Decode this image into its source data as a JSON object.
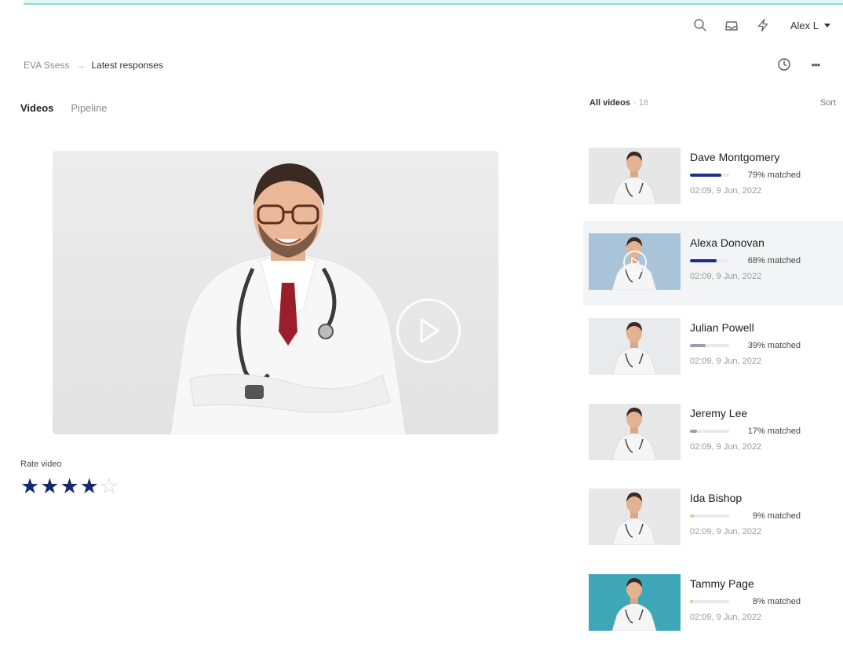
{
  "header": {
    "user_name": "Alex L",
    "icons": [
      "search-icon",
      "inbox-icon",
      "lightning-icon",
      "chevron-down-icon"
    ]
  },
  "breadcrumb": {
    "root": "EVA Ssess",
    "separator": "→",
    "current": "Latest responses"
  },
  "header_actions": {
    "icons": [
      "history-icon",
      "more-icon"
    ],
    "more_label": "•••"
  },
  "tabs": [
    {
      "label": "Videos",
      "active": true
    },
    {
      "label": "Pipeline",
      "active": false
    }
  ],
  "player": {
    "icon": "play-icon"
  },
  "rating": {
    "label": "Rate video",
    "value": 4,
    "max": 5,
    "filled_char": "★",
    "empty_char": "☆"
  },
  "list": {
    "title": "All videos",
    "count": "· 18",
    "sort_label": "Sort",
    "videos": [
      {
        "name": "Dave Montgomery",
        "match": "79% matched",
        "match_pct": 79,
        "bar_color": "#1a2f8f",
        "date": "02:09, 9 Jun, 2022",
        "selected": false,
        "thumb_bg": "#e6e6e6"
      },
      {
        "name": "Alexa Donovan",
        "match": "68% matched",
        "match_pct": 68,
        "bar_color": "#1a2f8f",
        "date": "02:09, 9 Jun, 2022",
        "selected": true,
        "thumb_bg": "#a9c4d8"
      },
      {
        "name": "Julian Powell",
        "match": "39% matched",
        "match_pct": 39,
        "bar_color": "#9a9fb0",
        "date": "02:09, 9 Jun, 2022",
        "selected": false,
        "thumb_bg": "#e9eaec"
      },
      {
        "name": "Jeremy Lee",
        "match": "17% matched",
        "match_pct": 17,
        "bar_color": "#9a9fb0",
        "date": "02:09, 9 Jun, 2022",
        "selected": false,
        "thumb_bg": "#e7e7e7"
      },
      {
        "name": "Ida Bishop",
        "match": "9% matched",
        "match_pct": 9,
        "bar_color": "#f2c28c",
        "date": "02:09, 9 Jun, 2022",
        "selected": false,
        "thumb_bg": "#e8e8e8"
      },
      {
        "name": "Tammy Page",
        "match": "8% matched",
        "match_pct": 8,
        "bar_color": "#f2c28c",
        "date": "02:09, 9 Jun, 2022",
        "selected": false,
        "thumb_bg": "#3fa6b8"
      }
    ]
  }
}
